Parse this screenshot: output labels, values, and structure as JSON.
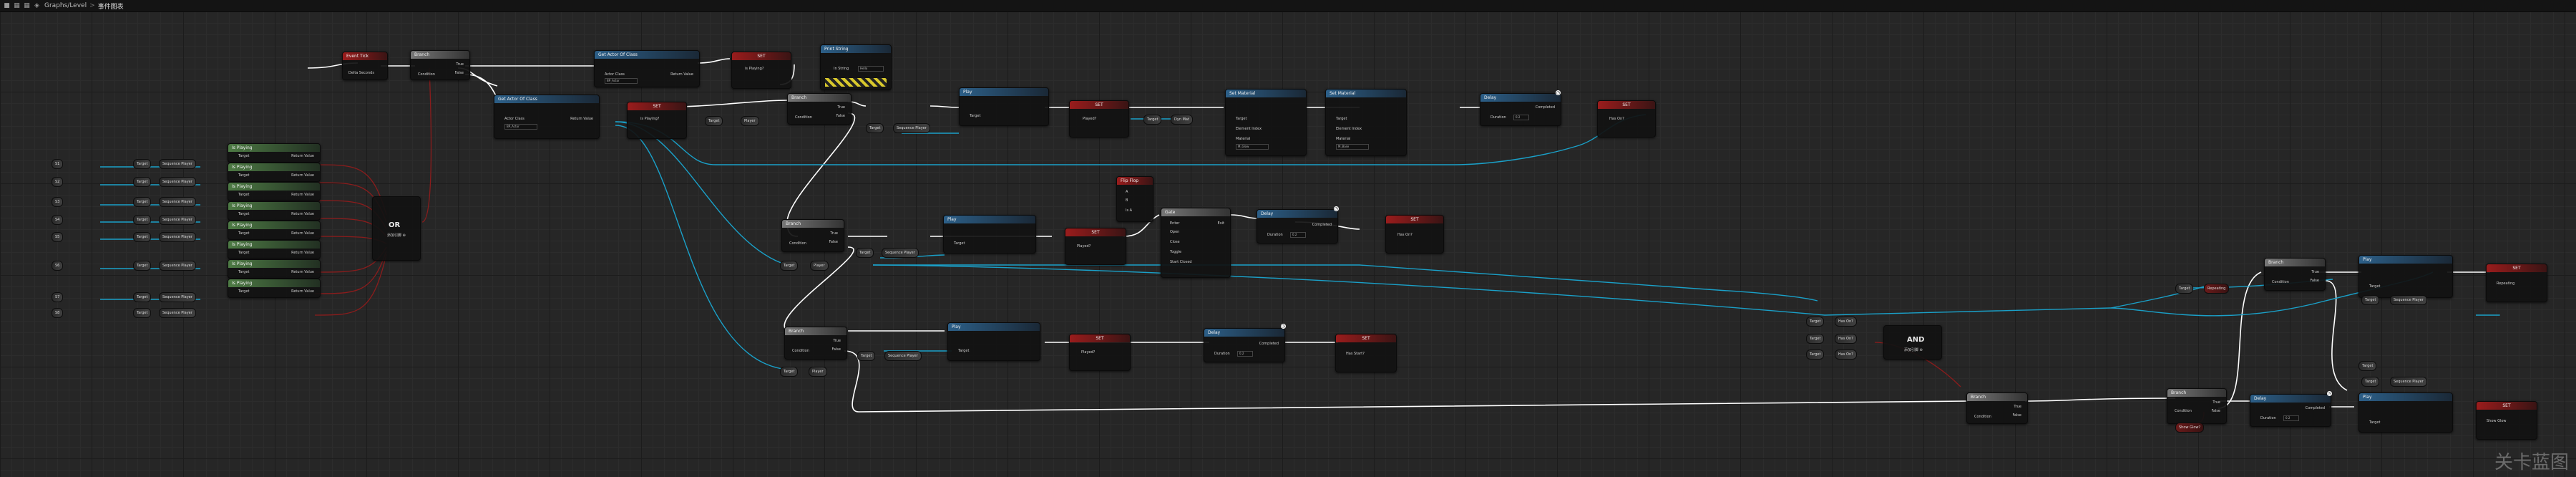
{
  "topbar": {
    "icons": [
      "save-icon",
      "grid-icon",
      "grid-icon",
      "blueprint-icon"
    ],
    "breadcrumb_root": "Graphs/Level",
    "breadcrumb_sep": ">",
    "breadcrumb_current": "事件图表"
  },
  "nodes": {
    "event_tick": {
      "title": "Event Tick",
      "pin": "Delta Seconds"
    },
    "branch_main": {
      "title": "Branch",
      "condition": "Condition",
      "true": "True",
      "false": "False"
    },
    "get_actors_class_1": {
      "title": "Get Actor Of Class",
      "actor_class": "Actor Class",
      "return": "Return Value",
      "class_value": "BP_Actor"
    },
    "set_is_playing": {
      "title": "SET",
      "var": "is Playing?"
    },
    "print_string": {
      "title": "Print String",
      "in_string": "In String",
      "value": "Hello"
    },
    "get_actors_class_2": {
      "title": "Get Actor Of Class",
      "actor_class": "Actor Class",
      "return": "Return Value",
      "class_value": "BP_Actor"
    },
    "set_is_playing_2": {
      "title": "SET",
      "var": "is Playing?"
    },
    "get_target": {
      "label": "Target"
    },
    "get_player": {
      "label": "Player"
    },
    "branch_a": {
      "title": "Branch",
      "condition": "Condition",
      "true": "True",
      "false": "False"
    },
    "target_seq_a": {
      "target": "Target",
      "seq": "Sequence Player"
    },
    "play_a": {
      "title": "Play",
      "target": "Target"
    },
    "set_played_a": {
      "title": "SET",
      "var": "Played?"
    },
    "get_mat_a": {
      "target": "Target",
      "mat": "Dyn Mat"
    },
    "set_material_1": {
      "title": "Set Material",
      "target": "Target",
      "element": "Element Index",
      "material": "Material",
      "material_value": "M_Glow"
    },
    "set_material_2": {
      "title": "Set Material",
      "target": "Target",
      "element": "Element Index",
      "material": "Material",
      "material_value": "M_Base"
    },
    "delay_a": {
      "title": "Delay",
      "duration": "Duration",
      "completed": "Completed",
      "value": "0.2"
    },
    "set_a_end": {
      "title": "SET",
      "var": "Has On?"
    },
    "ex_inputs": [
      {
        "label": "S1"
      },
      {
        "label": "S2"
      },
      {
        "label": "S3"
      },
      {
        "label": "S4"
      },
      {
        "label": "S5"
      },
      {
        "label": "S6"
      },
      {
        "label": "S7"
      },
      {
        "label": "S8"
      }
    ],
    "ex_targets": [
      "Target",
      "Target",
      "Target",
      "Target",
      "Target",
      "Target",
      "Target",
      "Target"
    ],
    "ex_seq": "Sequence Player",
    "is_playing_nodes": [
      {
        "title": "Is Playing",
        "target": "Target",
        "return": "Return Value"
      },
      {
        "title": "Is Playing",
        "target": "Target",
        "return": "Return Value"
      },
      {
        "title": "Is Playing",
        "target": "Target",
        "return": "Return Value"
      },
      {
        "title": "Is Playing",
        "target": "Target",
        "return": "Return Value"
      },
      {
        "title": "Is Playing",
        "target": "Target",
        "return": "Return Value"
      },
      {
        "title": "Is Playing",
        "target": "Target",
        "return": "Return Value"
      },
      {
        "title": "Is Playing",
        "target": "Target",
        "return": "Return Value"
      },
      {
        "title": "Is Playing",
        "target": "Target",
        "return": "Return Value"
      }
    ],
    "or_node": {
      "title": "OR",
      "add": "添加引脚 ⊕"
    },
    "branch_b": {
      "title": "Branch",
      "condition": "Condition",
      "true": "True",
      "false": "False"
    },
    "target_seq_b": {
      "target": "Target",
      "seq": "Sequence Player"
    },
    "play_b": {
      "title": "Play",
      "target": "Target"
    },
    "set_played_b": {
      "title": "SET",
      "var": "Played?"
    },
    "flipflop": {
      "title": "Flip Flop",
      "a": "A",
      "b": "B",
      "is_a": "Is A"
    },
    "gate": {
      "title": "Gate",
      "enter": "Enter",
      "exit": "Exit",
      "open": "Open",
      "close": "Close",
      "toggle": "Toggle",
      "start_closed": "Start Closed"
    },
    "delay_b": {
      "title": "Delay",
      "duration": "Duration",
      "completed": "Completed",
      "value": "0.2"
    },
    "set_b_end": {
      "title": "SET",
      "var": "Has On?"
    },
    "branch_c": {
      "title": "Branch",
      "condition": "Condition",
      "true": "True",
      "false": "False"
    },
    "target_seq_c": {
      "target": "Target",
      "seq": "Sequence Player"
    },
    "play_c": {
      "title": "Play",
      "target": "Target"
    },
    "set_played_c": {
      "title": "SET",
      "var": "Played?"
    },
    "delay_c": {
      "title": "Delay",
      "duration": "Duration",
      "completed": "Completed",
      "value": "0.2"
    },
    "set_c_end": {
      "title": "SET",
      "var": "Has Start?"
    },
    "target_getters_c": [
      "Target",
      "Target",
      "Target"
    ],
    "has_vars": [
      "Has On?",
      "Has On?",
      "Has On?"
    ],
    "and_node": {
      "title": "AND",
      "add": "添加引脚 ⊕"
    },
    "branch_d": {
      "title": "Branch",
      "condition": "Condition",
      "true": "True",
      "false": "False"
    },
    "branch_e": {
      "title": "Branch",
      "condition": "Condition",
      "true": "True",
      "false": "False"
    },
    "target_seq_e": {
      "target": "Target",
      "seq": "Sequence Player"
    },
    "play_e": {
      "title": "Play",
      "target": "Target"
    },
    "set_e_end": {
      "title": "SET",
      "var": "Repeating"
    },
    "delay_e": {
      "title": "Delay",
      "duration": "Duration",
      "completed": "Completed",
      "value": "0.2"
    },
    "play_f": {
      "title": "Play",
      "target": "Target"
    },
    "set_f_end": {
      "title": "SET",
      "var": "Show Glow"
    },
    "branch_f_var": "Show Glow?"
  },
  "watermark": "关卡蓝图",
  "colors": {
    "exec": "#ffffff",
    "object": "#1aa0c8",
    "bool": "#8b1c1c",
    "red_header": "#9a1c1c",
    "blue_header": "#2c5f88",
    "green_header": "#4d7a44"
  }
}
